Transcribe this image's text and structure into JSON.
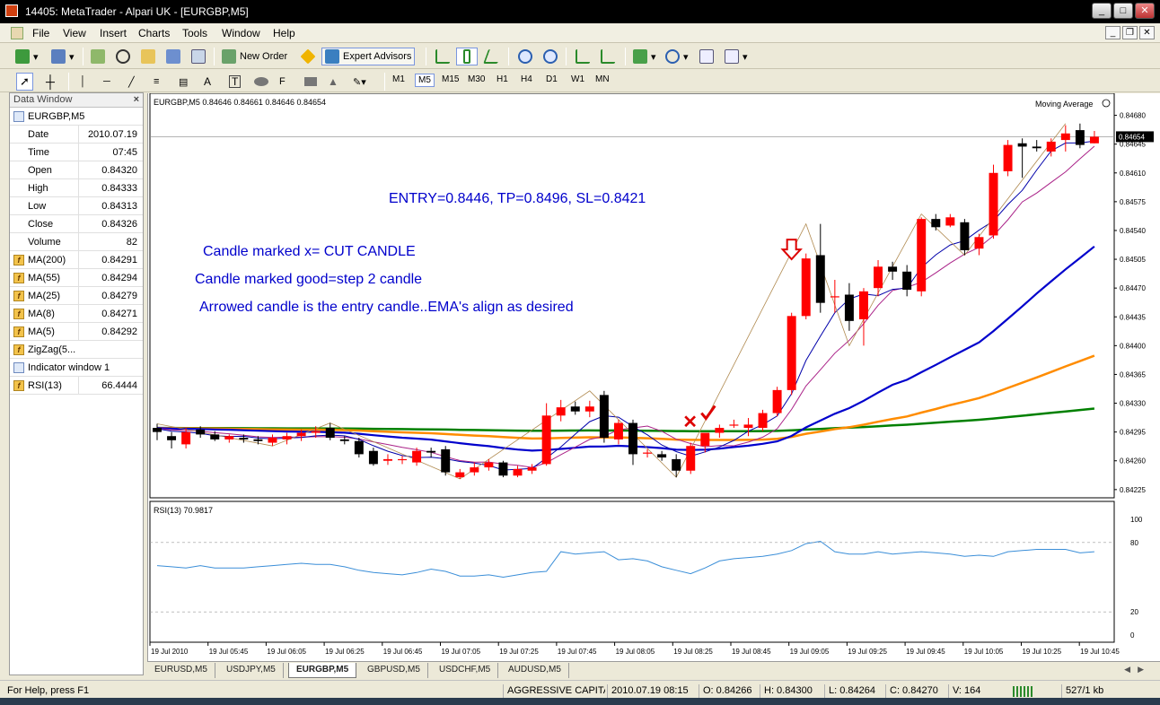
{
  "window": {
    "title": "14405: MetaTrader - Alpari UK - [EURGBP,M5]"
  },
  "menu": [
    "File",
    "View",
    "Insert",
    "Charts",
    "Tools",
    "Window",
    "Help"
  ],
  "toolbar": {
    "new_order": "New Order",
    "expert_advisors": "Expert Advisors"
  },
  "timeframes": {
    "items": [
      "M1",
      "M5",
      "M15",
      "M30",
      "H1",
      "H4",
      "D1",
      "W1",
      "MN"
    ],
    "active": "M5"
  },
  "data_window": {
    "title": "Data Window",
    "symbol": "EURGBP,M5",
    "rows": [
      {
        "label": "Date",
        "value": "2010.07.19"
      },
      {
        "label": "Time",
        "value": "07:45"
      },
      {
        "label": "Open",
        "value": "0.84320"
      },
      {
        "label": "High",
        "value": "0.84333"
      },
      {
        "label": "Low",
        "value": "0.84313"
      },
      {
        "label": "Close",
        "value": "0.84326"
      },
      {
        "label": "Volume",
        "value": "82"
      }
    ],
    "indicators": [
      {
        "label": "MA(200)",
        "value": "0.84291"
      },
      {
        "label": "MA(55)",
        "value": "0.84294"
      },
      {
        "label": "MA(25)",
        "value": "0.84279"
      },
      {
        "label": "MA(8)",
        "value": "0.84271"
      },
      {
        "label": "MA(5)",
        "value": "0.84292"
      }
    ],
    "zigzag": "ZigZag(5...",
    "indicator_window": "Indicator window 1",
    "rsi": {
      "label": "RSI(13)",
      "value": "66.4444"
    }
  },
  "chart": {
    "header": "EURGBP,M5  0.84646 0.84661 0.84646 0.84654",
    "indicator_name": "Moving Average",
    "current_price": "0.84654",
    "price_labels": [
      "0.84680",
      "0.84645",
      "0.84610",
      "0.84575",
      "0.84540",
      "0.84505",
      "0.84470",
      "0.84435",
      "0.84400",
      "0.84365",
      "0.84330",
      "0.84295",
      "0.84260",
      "0.84225"
    ],
    "annotations": {
      "entry": "ENTRY=0.8446,  TP=0.8496, SL=0.8421",
      "line1": "Candle marked x= CUT CANDLE",
      "line2": "Candle marked good=step 2 candle",
      "line3": "Arrowed candle is the entry candle..EMA's align as desired"
    },
    "rsi_header": "RSI(13) 70.9817",
    "rsi_labels": [
      "100",
      "80",
      "20",
      "0"
    ],
    "time_labels": [
      "19 Jul 2010",
      "19 Jul 05:45",
      "19 Jul 06:05",
      "19 Jul 06:25",
      "19 Jul 06:45",
      "19 Jul 07:05",
      "19 Jul 07:25",
      "19 Jul 07:45",
      "19 Jul 08:05",
      "19 Jul 08:25",
      "19 Jul 08:45",
      "19 Jul 09:05",
      "19 Jul 09:25",
      "19 Jul 09:45",
      "19 Jul 10:05",
      "19 Jul 10:25",
      "19 Jul 10:45"
    ],
    "colors": {
      "bull": "#ff0000",
      "bear": "#000000",
      "ma_thin": "#0000aa",
      "ma_blue": "#0000cc",
      "ma_orange": "#ff8c00",
      "ma_green": "#008000",
      "ma_violet": "#aa2288",
      "zigzag": "#b08a50",
      "rsi": "#3a8ed8"
    }
  },
  "chart_data": {
    "type": "candlestick",
    "symbol": "EURGBP",
    "timeframe": "M5",
    "candles": [
      [
        0.843,
        0.84305,
        0.84285,
        0.84295
      ],
      [
        0.8429,
        0.84295,
        0.84275,
        0.84285
      ],
      [
        0.8428,
        0.843,
        0.84275,
        0.84295
      ],
      [
        0.84298,
        0.84302,
        0.84288,
        0.84292
      ],
      [
        0.84292,
        0.84296,
        0.84284,
        0.84286
      ],
      [
        0.84286,
        0.84292,
        0.84282,
        0.8429
      ],
      [
        0.84288,
        0.84292,
        0.84282,
        0.84286
      ],
      [
        0.84286,
        0.8429,
        0.8428,
        0.84284
      ],
      [
        0.84282,
        0.84292,
        0.84278,
        0.84288
      ],
      [
        0.84286,
        0.84294,
        0.8428,
        0.8429
      ],
      [
        0.8429,
        0.84298,
        0.84284,
        0.84294
      ],
      [
        0.84294,
        0.84302,
        0.84288,
        0.84296
      ],
      [
        0.843,
        0.84306,
        0.84285,
        0.84288
      ],
      [
        0.84286,
        0.8429,
        0.8428,
        0.84284
      ],
      [
        0.84284,
        0.84288,
        0.84264,
        0.84268
      ],
      [
        0.84272,
        0.84276,
        0.84254,
        0.84256
      ],
      [
        0.8426,
        0.84268,
        0.84255,
        0.84262
      ],
      [
        0.84262,
        0.84266,
        0.84256,
        0.84262
      ],
      [
        0.84258,
        0.84276,
        0.84254,
        0.84272
      ],
      [
        0.84272,
        0.84276,
        0.84264,
        0.8427
      ],
      [
        0.84274,
        0.84278,
        0.84242,
        0.84246
      ],
      [
        0.8424,
        0.8425,
        0.84238,
        0.84246
      ],
      [
        0.84246,
        0.84258,
        0.84242,
        0.84252
      ],
      [
        0.84252,
        0.84262,
        0.84248,
        0.84258
      ],
      [
        0.84258,
        0.8426,
        0.8424,
        0.84242
      ],
      [
        0.84242,
        0.84254,
        0.8424,
        0.8425
      ],
      [
        0.84248,
        0.84256,
        0.84244,
        0.84252
      ],
      [
        0.84256,
        0.8433,
        0.84254,
        0.84315
      ],
      [
        0.84315,
        0.84334,
        0.84308,
        0.84325
      ],
      [
        0.84326,
        0.84332,
        0.84316,
        0.8432
      ],
      [
        0.8432,
        0.84333,
        0.84313,
        0.84326
      ],
      [
        0.8434,
        0.84345,
        0.84282,
        0.84288
      ],
      [
        0.84286,
        0.8431,
        0.8428,
        0.84306
      ],
      [
        0.84306,
        0.8431,
        0.84255,
        0.84268
      ],
      [
        0.8427,
        0.84274,
        0.84264,
        0.8427
      ],
      [
        0.84268,
        0.84272,
        0.8426,
        0.84264
      ],
      [
        0.84262,
        0.84268,
        0.8424,
        0.84248
      ],
      [
        0.84248,
        0.84282,
        0.84244,
        0.84278
      ],
      [
        0.84278,
        0.84292,
        0.8427,
        0.84294
      ],
      [
        0.84294,
        0.84304,
        0.84288,
        0.843
      ],
      [
        0.84304,
        0.8431,
        0.843,
        0.84304
      ],
      [
        0.843,
        0.84312,
        0.8429,
        0.84304
      ],
      [
        0.843,
        0.84322,
        0.84296,
        0.84318
      ],
      [
        0.84318,
        0.8435,
        0.84314,
        0.84346
      ],
      [
        0.84346,
        0.8444,
        0.8434,
        0.84436
      ],
      [
        0.84436,
        0.84512,
        0.84432,
        0.84506
      ],
      [
        0.8451,
        0.84548,
        0.8444,
        0.84452
      ],
      [
        0.8446,
        0.8448,
        0.8444,
        0.8446
      ],
      [
        0.84462,
        0.84476,
        0.84418,
        0.8443
      ],
      [
        0.84432,
        0.8447,
        0.844,
        0.84466
      ],
      [
        0.8447,
        0.84504,
        0.8446,
        0.84496
      ],
      [
        0.84496,
        0.84502,
        0.8448,
        0.8449
      ],
      [
        0.8449,
        0.84498,
        0.8446,
        0.84468
      ],
      [
        0.84466,
        0.84556,
        0.8446,
        0.84554
      ],
      [
        0.84554,
        0.8456,
        0.8454,
        0.84544
      ],
      [
        0.84546,
        0.8456,
        0.84544,
        0.84556
      ],
      [
        0.8455,
        0.84554,
        0.8451,
        0.84516
      ],
      [
        0.84518,
        0.84536,
        0.8451,
        0.84532
      ],
      [
        0.84534,
        0.8462,
        0.8453,
        0.8461
      ],
      [
        0.84612,
        0.8465,
        0.84606,
        0.84644
      ],
      [
        0.84646,
        0.84652,
        0.84604,
        0.84642
      ],
      [
        0.84642,
        0.8465,
        0.84636,
        0.8464
      ],
      [
        0.84636,
        0.84652,
        0.8463,
        0.84648
      ],
      [
        0.8465,
        0.84668,
        0.84636,
        0.84658
      ],
      [
        0.84662,
        0.8467,
        0.8464,
        0.84644
      ],
      [
        0.84646,
        0.84661,
        0.84646,
        0.84654
      ]
    ],
    "rsi": [
      60,
      59,
      58,
      60,
      58,
      58,
      58,
      59,
      60,
      61,
      62,
      61,
      61,
      59,
      56,
      54,
      53,
      52,
      54,
      57,
      55,
      51,
      51,
      52,
      50,
      52,
      54,
      55,
      72,
      70,
      71,
      72,
      65,
      66,
      64,
      59,
      56,
      53,
      58,
      64,
      66,
      67,
      68,
      70,
      73,
      79,
      81,
      72,
      70,
      70,
      72,
      70,
      71,
      72,
      71,
      70,
      68,
      69,
      68,
      72,
      73,
      74,
      74,
      74,
      71,
      72
    ],
    "ylim": [
      0.84215,
      0.84685
    ],
    "rsi_ylim": [
      0,
      100
    ]
  },
  "tabs": {
    "items": [
      "EURUSD,M5",
      "USDJPY,M5",
      "EURGBP,M5",
      "GBPUSD,M5",
      "USDCHF,M5",
      "AUDUSD,M5"
    ],
    "active": "EURGBP,M5"
  },
  "status": {
    "help": "For Help, press F1",
    "profile": "AGGRESSIVE CAPITAL T",
    "datetime": "2010.07.19 08:15",
    "open": "O: 0.84266",
    "high": "H: 0.84300",
    "low": "L: 0.84264",
    "close": "C: 0.84270",
    "volume": "V: 164",
    "traffic": "527/1 kb"
  }
}
